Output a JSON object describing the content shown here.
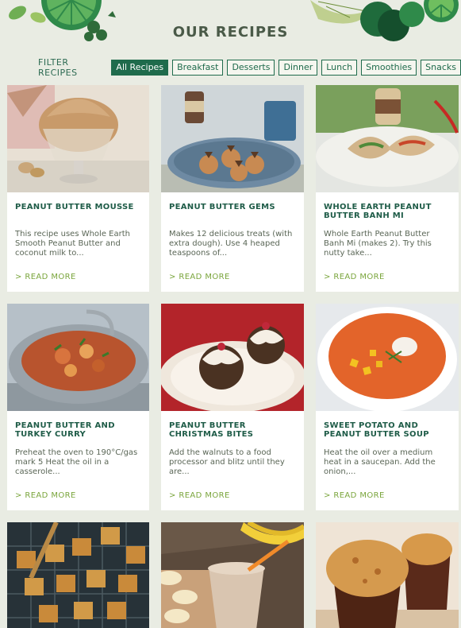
{
  "page": {
    "title": "OUR RECIPES"
  },
  "filter": {
    "label": "FILTER RECIPES",
    "buttons": [
      "All Recipes",
      "Breakfast",
      "Desserts",
      "Dinner",
      "Lunch",
      "Smoothies",
      "Snacks"
    ],
    "active": "All Recipes"
  },
  "recipes": [
    {
      "title": "PEANUT BUTTER MOUSSE",
      "text": "This recipe uses Whole Earth Smooth Peanut Butter and coconut milk to...",
      "link": "> READ MORE"
    },
    {
      "title": "PEANUT BUTTER GEMS",
      "text": "Makes 12 delicious treats (with extra dough). Use 4 heaped teaspoons of...",
      "link": "> READ MORE"
    },
    {
      "title": "WHOLE EARTH PEANUT BUTTER BANH MI",
      "text": "Whole Earth Peanut Butter Banh Mi (makes 2). Try this nutty take...",
      "link": "> READ MORE"
    },
    {
      "title": "PEANUT BUTTER AND TURKEY CURRY",
      "text": "Preheat the oven to 190°C/gas mark 5 Heat the oil in a casserole...",
      "link": "> READ MORE"
    },
    {
      "title": "PEANUT BUTTER CHRISTMAS BITES",
      "text": "Add the walnuts to a food processor and blitz until they are...",
      "link": "> READ MORE"
    },
    {
      "title": "SWEET POTATO AND PEANUT BUTTER SOUP",
      "text": "Heat the oil over a medium heat in a saucepan. Add the onion,...",
      "link": "> READ MORE"
    }
  ]
}
